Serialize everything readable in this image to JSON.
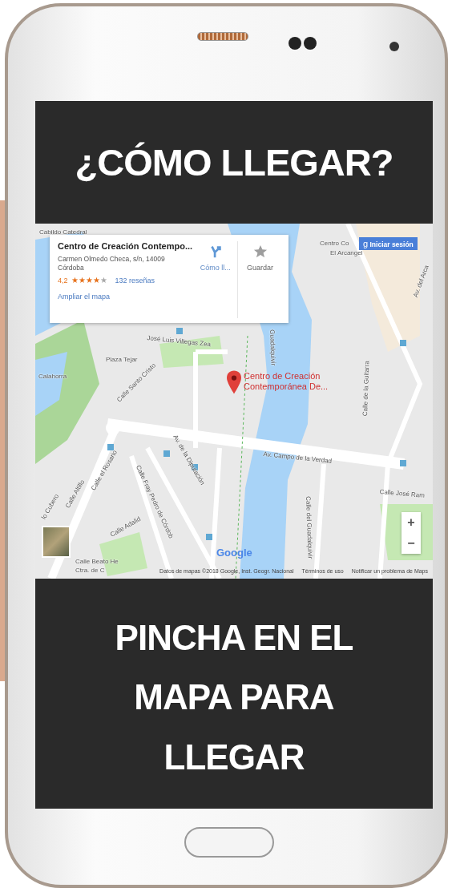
{
  "heading": "¿CÓMO LLEGAR?",
  "map": {
    "place_card": {
      "title": "Centro de Creación Contempo...",
      "address": [
        "Carmen Olmedo Checa, s/n, 14009",
        "Córdoba"
      ],
      "rating": "4,2",
      "stars": 4,
      "reviews": "132 reseñas",
      "link": "Ampliar el mapa",
      "actions": [
        {
          "kind": "directions",
          "label": "Cómo ll..."
        },
        {
          "kind": "save",
          "label": "Guardar"
        }
      ]
    },
    "sign_in_icon": "g",
    "sign_in": "Iniciar sesión",
    "labels": [
      {
        "text": "Cabildo Catedral"
      },
      {
        "text": "Centro Co"
      },
      {
        "text": "El Arcangel"
      },
      {
        "text": "Av. del Arca"
      },
      {
        "text": "José Luis Villegas Zea"
      },
      {
        "text": "Guadalquivir"
      },
      {
        "text": "Plaza Tejar"
      },
      {
        "text": "Calahorra"
      },
      {
        "text": "Calle Santo Cristo"
      },
      {
        "text": "Av. de la Diputación"
      },
      {
        "text": "Av. Campo de la Verdad"
      },
      {
        "text": "Calle del Guadalquivir"
      },
      {
        "text": "Calle de la Guitarra"
      },
      {
        "text": "Calle José Ram"
      },
      {
        "text": "Calle el Rosario"
      },
      {
        "text": "Calle Fray Pedro de Córdob"
      },
      {
        "text": "Calle Altillo"
      },
      {
        "text": "lo Cubero"
      },
      {
        "text": "Calle Adalid"
      },
      {
        "text": "Calle Beato He"
      },
      {
        "text": "Ctra. de C"
      }
    ],
    "pin_label": [
      "Centro de Creación",
      "Contemporánea De..."
    ],
    "zoom": [
      "+",
      "−"
    ],
    "logo": "Google",
    "footer": [
      "Datos de mapas ©2018 Google, Inst. Geogr. Nacional",
      "Términos de uso",
      "Notificar un problema de Maps"
    ]
  },
  "call_to_action": [
    "PINCHA EN EL",
    "MAPA PARA",
    "LLEGAR"
  ]
}
